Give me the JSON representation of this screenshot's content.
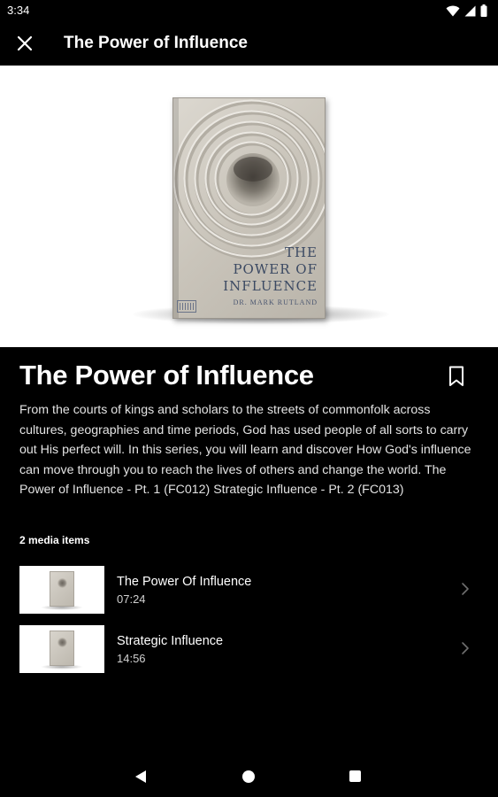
{
  "status_bar": {
    "time": "3:34",
    "icons": [
      "wifi-icon",
      "signal-icon",
      "battery-icon"
    ]
  },
  "app_bar": {
    "close_icon": "close-icon",
    "title": "The Power of Influence"
  },
  "hero": {
    "cover": {
      "title_lines": [
        "THE",
        "POWER OF",
        "INFLUENCE"
      ],
      "author": "DR. MARK RUTLAND"
    }
  },
  "series": {
    "title": "The Power of Influence",
    "bookmark_icon": "bookmark-icon",
    "description": "From the courts of kings and scholars to the streets of commonfolk across cultures, geographies and time periods, God has used people of all sorts to carry out His perfect will. In this series, you will learn and discover How God's influence can move through you to reach the lives of others and change the world. The Power of Influence - Pt. 1 (FC012) Strategic Influence - Pt. 2 (FC013)",
    "media_count": "2 media items"
  },
  "media_items": [
    {
      "title": "The Power Of Influence",
      "duration": "07:24"
    },
    {
      "title": "Strategic Influence",
      "duration": "14:56"
    }
  ],
  "nav_bar": {
    "icons": [
      "back-icon",
      "home-icon",
      "recents-icon"
    ]
  },
  "colors": {
    "background": "#000000",
    "text": "#ffffff",
    "description_text": "#e3e3e3",
    "hero_background": "#ffffff"
  }
}
